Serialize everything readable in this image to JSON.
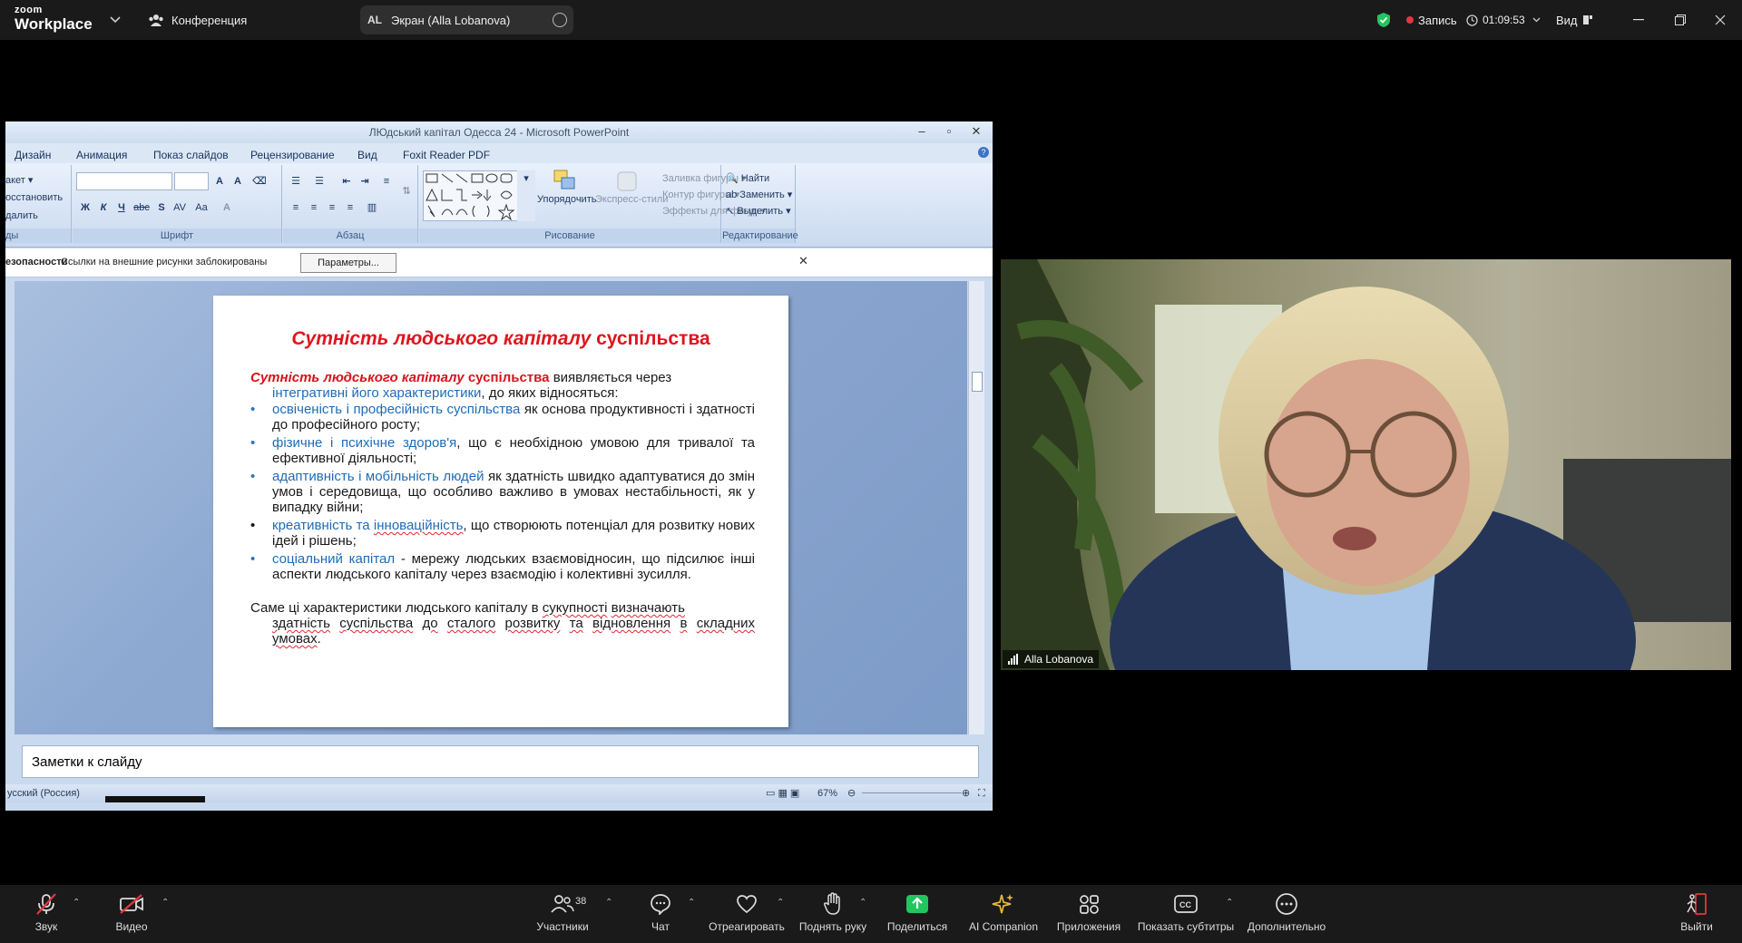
{
  "titlebar": {
    "logo_top": "zoom",
    "logo_bottom": "Workplace",
    "meeting_label": "Конференция",
    "share_initials": "AL",
    "share_label": "Экран (Alla Lobanova)",
    "recording_label": "Запись",
    "timer": "01:09:53",
    "view_label": "Вид"
  },
  "ppt": {
    "window_title": "ЛЮдський капітал Одесса 24 - Microsoft PowerPoint",
    "tabs": [
      "Дизайн",
      "Анимация",
      "Показ слайдов",
      "Рецензирование",
      "Вид",
      "Foxit Reader PDF"
    ],
    "clipboard": {
      "items": [
        "акет ▾",
        "осстановить",
        "далить"
      ],
      "group": "ды"
    },
    "font_group": "Шрифт",
    "paragraph_group": "Абзац",
    "drawing": {
      "group": "Рисование",
      "arrange": "Упорядочить",
      "quick_styles": "Экспресс-стили",
      "fill": "Заливка фигуры ▾",
      "outline": "Контур фигуры ▾",
      "effects": "Эффекты для фигур ▾"
    },
    "editing": {
      "group": "Редактирование",
      "find": "Найти",
      "replace": "Заменить ▾",
      "select": "Выделить ▾"
    },
    "security_bar": {
      "label": "езопасности",
      "message": "Ссылки на внешние рисунки заблокированы",
      "button": "Параметры..."
    },
    "notes_placeholder": "Заметки к слайду",
    "status_language": "усский (Россия)",
    "zoom_level": "67%"
  },
  "slide": {
    "title_italic": "Сутність людського капіталу",
    "title_normal": "суспільства",
    "intro_red_italic": "Сутність людського капіталу",
    "intro_red": "суспільства",
    "intro_rest": "виявляється через",
    "intro_blue": "інтегративні його характеристики",
    "intro_end": ", до яких відносяться:",
    "bullets": [
      {
        "blue": "освіченість і професійність суспільства",
        "rest": " як основа продуктивності і здатності до професійного росту;"
      },
      {
        "blue": "фізичне і психічне здоров'я",
        "rest": ", що є необхідною умовою для тривалої та ефективної діяльності;"
      },
      {
        "blue": "адаптивність і мобільність людей",
        "rest": " як здатність швидко адаптуватися до змін умов і середовища, що особливо важливо в умовах нестабільності, як у випадку війни;"
      },
      {
        "blue": " креативність та ",
        "blue2": "інноваційність",
        "rest": ", що створюють потенціал для розвитку нових ідей і рішень;"
      },
      {
        "blue": " соціальний капітал",
        "rest": " - мережу людських взаємовідносин, що підсилює інші аспекти людського капіталу через взаємодію і колективні зусилля."
      }
    ],
    "conclusion_a": "Саме ці характеристики людського капіталу в ",
    "conclusion_w1": "сукупності",
    "conclusion_b": " ",
    "conclusion_w2": "визначають",
    "conclusion_w3": "здатність",
    "conclusion_c": " ",
    "conclusion_w4": "суспільства",
    "conclusion_d": " ",
    "conclusion_w5": "до",
    "conclusion_e": " ",
    "conclusion_w6": "сталого",
    "conclusion_f": " ",
    "conclusion_w7": "розвитку",
    "conclusion_g": " ",
    "conclusion_w8": "та",
    "conclusion_h": " ",
    "conclusion_w9": "відновлення",
    "conclusion_i": " ",
    "conclusion_w10": "в",
    "conclusion_j": " ",
    "conclusion_w11": "складних",
    "conclusion_w12": "умовах",
    "conclusion_end": "."
  },
  "video": {
    "participant_name": "Alla Lobanova"
  },
  "toolbar": {
    "audio": "Звук",
    "video": "Видео",
    "participants": "Участники",
    "participants_count": "38",
    "chat": "Чат",
    "react": "Отреагировать",
    "raise_hand": "Поднять руку",
    "share": "Поделиться",
    "ai": "AI Companion",
    "apps": "Приложения",
    "captions": "Показать субтитры",
    "more": "Дополнительно",
    "leave": "Выйти"
  },
  "colors": {
    "accent_green": "#22c55e",
    "record_red": "#e0383e",
    "slide_red": "#d6141b",
    "slide_blue": "#1f6bb8"
  }
}
